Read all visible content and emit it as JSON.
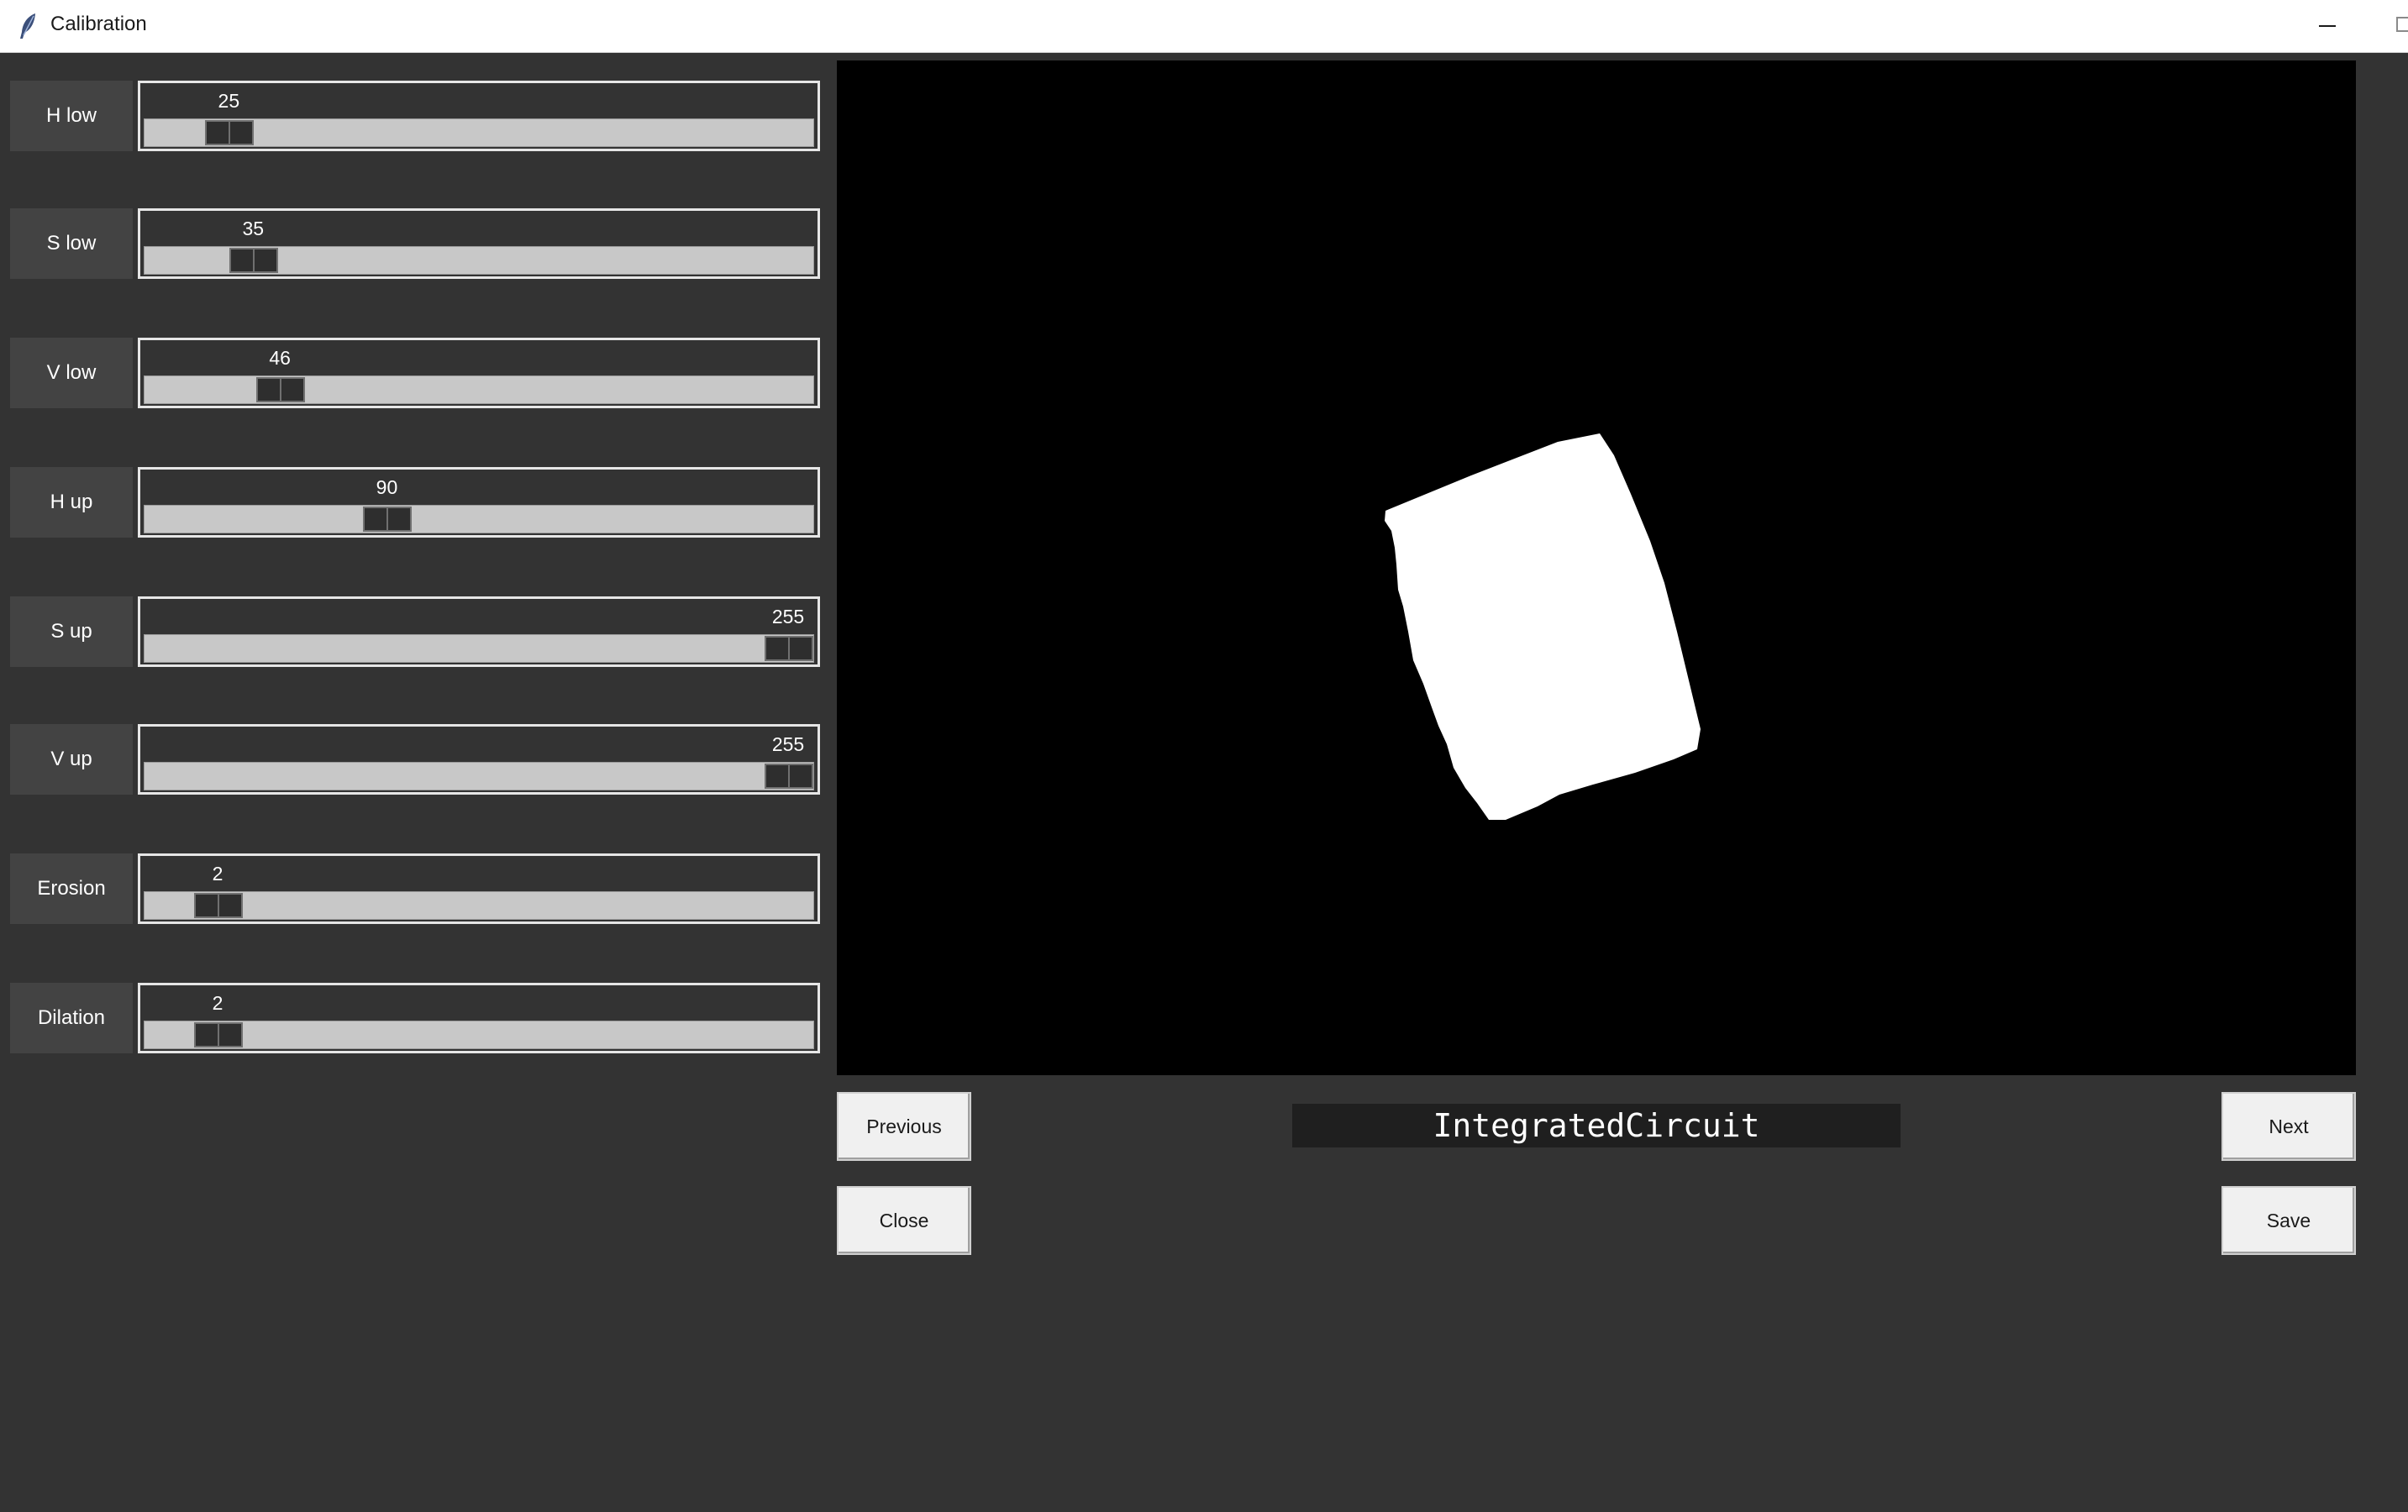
{
  "window": {
    "title": "Calibration",
    "icons": {
      "app": "feather-icon",
      "minimize": "minimize-icon",
      "maximize": "maximize-icon"
    }
  },
  "sliders": [
    {
      "label": "H low",
      "value": 25,
      "min": 0,
      "max": 255
    },
    {
      "label": "S low",
      "value": 35,
      "min": 0,
      "max": 255
    },
    {
      "label": "V low",
      "value": 46,
      "min": 0,
      "max": 255
    },
    {
      "label": "H up",
      "value": 90,
      "min": 0,
      "max": 255
    },
    {
      "label": "S up",
      "value": 255,
      "min": 0,
      "max": 255
    },
    {
      "label": "V up",
      "value": 255,
      "min": 0,
      "max": 255
    },
    {
      "label": "Erosion",
      "value": 2,
      "min": 0,
      "max": 25
    },
    {
      "label": "Dilation",
      "value": 2,
      "min": 0,
      "max": 25
    }
  ],
  "controls": {
    "previous_label": "Previous",
    "next_label": "Next",
    "close_label": "Close",
    "save_label": "Save",
    "class_name": "IntegratedCircuit"
  },
  "colors": {
    "background": "#333333",
    "mask_foreground": "#ffffff",
    "mask_background": "#000000"
  }
}
